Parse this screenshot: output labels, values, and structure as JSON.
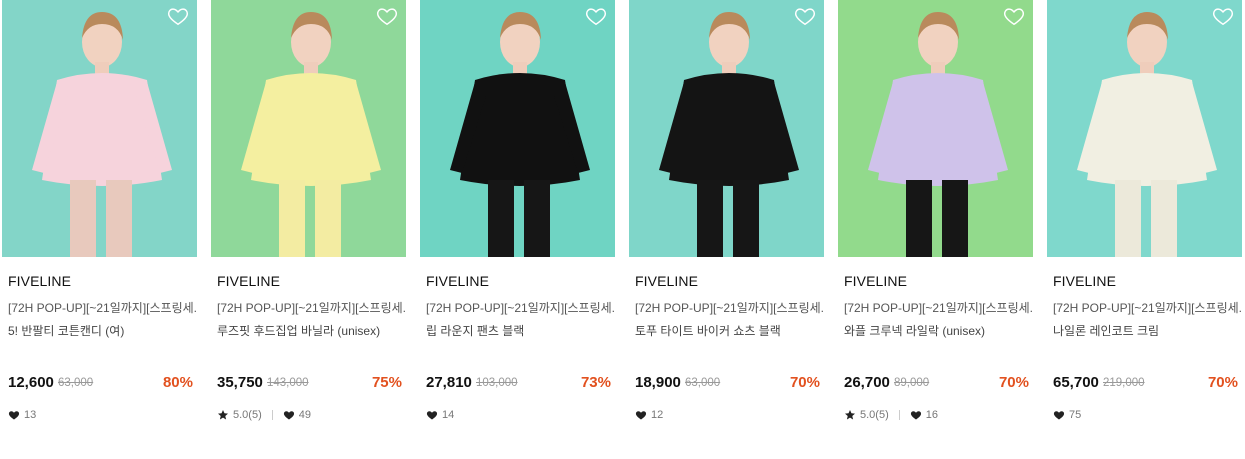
{
  "colors": {
    "discount": "#e2511f",
    "heart_fill": "#222222",
    "wishlist_outline": "#ffffff"
  },
  "products": [
    {
      "brand": "FIVELINE",
      "title_line1": "[72H POP-UP][~21일까지][스프링세...",
      "title_line2": "5! 반팔티 코튼캔디 (여)",
      "price": "12,600",
      "original_price": "63,000",
      "discount": "80%",
      "rating": "",
      "likes": "13",
      "bg": "#83d5c8",
      "outfit": "#f6d3dc"
    },
    {
      "brand": "FIVELINE",
      "title_line1": "[72H POP-UP][~21일까지][스프링세...",
      "title_line2": "루즈핏 후드집업 바닐라 (unisex)",
      "price": "35,750",
      "original_price": "143,000",
      "discount": "75%",
      "rating": "5.0(5)",
      "likes": "49",
      "bg": "#8fd89a",
      "outfit": "#f4efa0"
    },
    {
      "brand": "FIVELINE",
      "title_line1": "[72H POP-UP][~21일까지][스프링세...",
      "title_line2": "립 라운지 팬츠 블랙",
      "price": "27,810",
      "original_price": "103,000",
      "discount": "73%",
      "rating": "",
      "likes": "14",
      "bg": "#6fd4c3",
      "outfit": "#111111"
    },
    {
      "brand": "FIVELINE",
      "title_line1": "[72H POP-UP][~21일까지][스프링세...",
      "title_line2": "토푸 타이트 바이커 쇼츠 블랙",
      "price": "18,900",
      "original_price": "63,000",
      "discount": "70%",
      "rating": "",
      "likes": "12",
      "bg": "#7fd6c9",
      "outfit": "#141414"
    },
    {
      "brand": "FIVELINE",
      "title_line1": "[72H POP-UP][~21일까지][스프링세...",
      "title_line2": "와플 크루넥 라일락 (unisex)",
      "price": "26,700",
      "original_price": "89,000",
      "discount": "70%",
      "rating": "5.0(5)",
      "likes": "16",
      "bg": "#92da8c",
      "outfit": "#cfc2ea"
    },
    {
      "brand": "FIVELINE",
      "title_line1": "[72H POP-UP][~21일까지][스프링세...",
      "title_line2": "나일론 레인코트 크림",
      "price": "65,700",
      "original_price": "219,000",
      "discount": "70%",
      "rating": "",
      "likes": "75",
      "bg": "#7fd8cc",
      "outfit": "#f1efe2"
    }
  ]
}
